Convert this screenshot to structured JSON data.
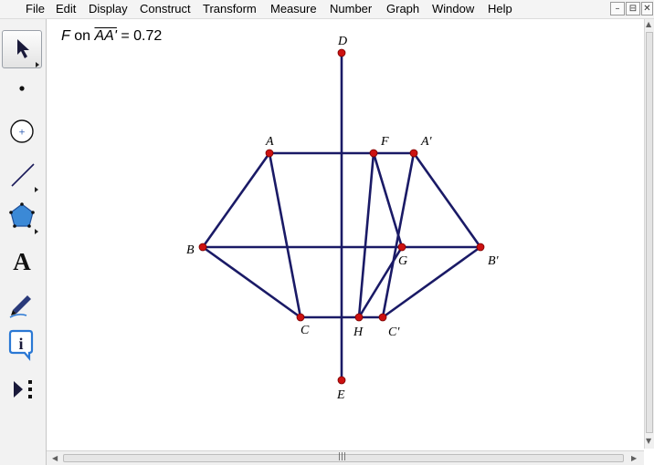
{
  "menu": [
    "File",
    "Edit",
    "Display",
    "Construct",
    "Transform",
    "Measure",
    "Number",
    "Graph",
    "Window",
    "Help"
  ],
  "window_buttons": {
    "minimize": "–",
    "restore": "⊟",
    "close": "✕"
  },
  "tools": [
    {
      "name": "arrow-tool",
      "active": true
    },
    {
      "name": "point-tool",
      "active": false
    },
    {
      "name": "compass-tool",
      "active": false
    },
    {
      "name": "straightedge-tool",
      "active": false
    },
    {
      "name": "polygon-tool",
      "active": false
    },
    {
      "name": "text-tool",
      "active": false,
      "glyph": "A"
    },
    {
      "name": "marker-tool",
      "active": false
    },
    {
      "name": "information-tool",
      "active": false,
      "glyph": "i"
    },
    {
      "name": "custom-tool",
      "active": false
    }
  ],
  "measurement": {
    "point": "F",
    "connector": " on ",
    "segment": "AA'",
    "equals": " = ",
    "value": "0.72"
  },
  "colors": {
    "segment": "#1a1a66",
    "point": "#cc1111"
  },
  "points": {
    "A": {
      "label": "A"
    },
    "F": {
      "label": "F"
    },
    "A2": {
      "label": "A'"
    },
    "B": {
      "label": "B"
    },
    "G": {
      "label": "G"
    },
    "B2": {
      "label": "B'"
    },
    "C": {
      "label": "C"
    },
    "H": {
      "label": "H"
    },
    "C2": {
      "label": "C'"
    },
    "D": {
      "label": "D"
    },
    "E": {
      "label": "E"
    }
  },
  "segments": [
    [
      "D",
      "E"
    ],
    [
      "A",
      "A2"
    ],
    [
      "B",
      "B2"
    ],
    [
      "C",
      "C2"
    ],
    [
      "A",
      "B"
    ],
    [
      "B",
      "C"
    ],
    [
      "A",
      "C"
    ],
    [
      "A2",
      "B2"
    ],
    [
      "B2",
      "C2"
    ],
    [
      "A2",
      "C2"
    ],
    [
      "F",
      "G"
    ],
    [
      "G",
      "H"
    ],
    [
      "F",
      "H"
    ]
  ],
  "hscroll": {
    "grip": "|||"
  }
}
